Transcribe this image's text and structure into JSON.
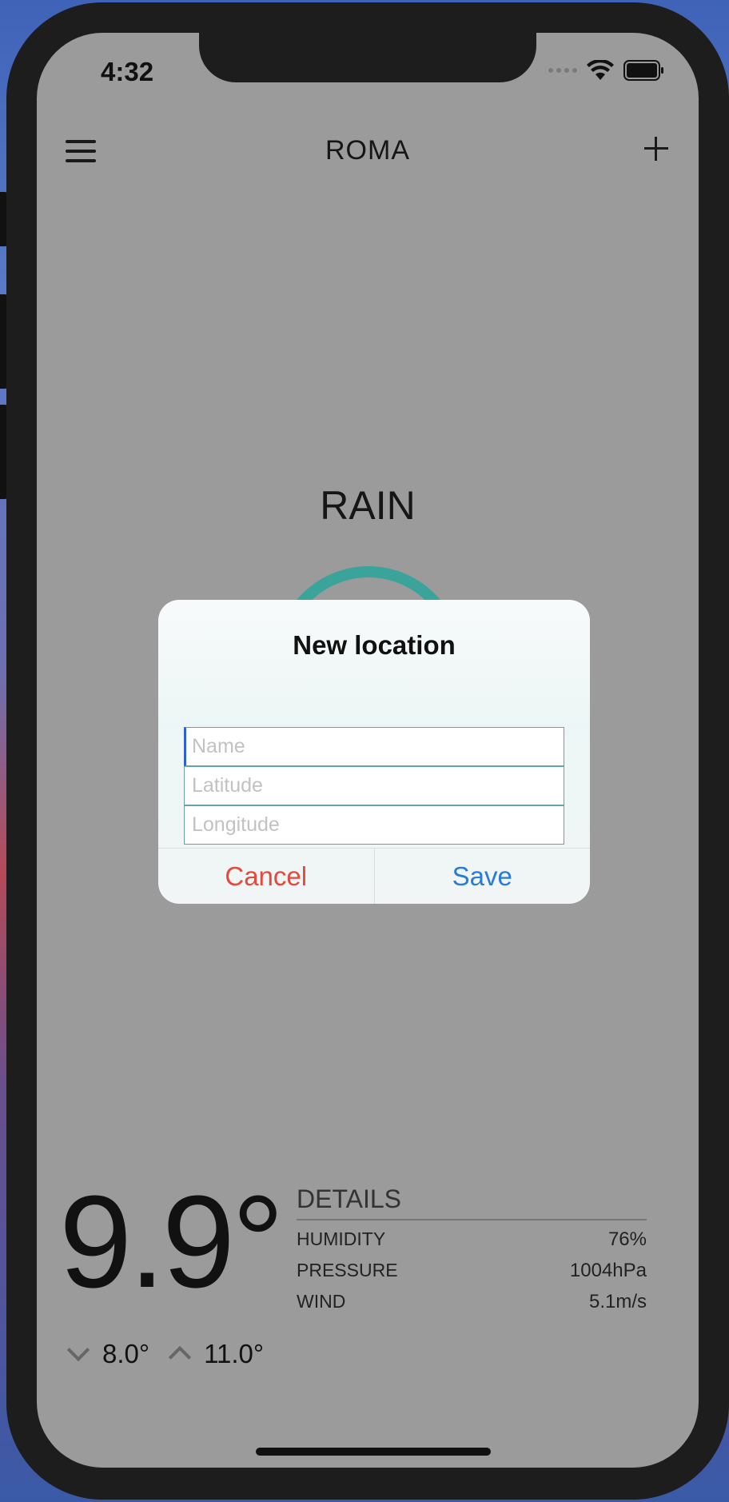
{
  "status_bar": {
    "time": "4:32"
  },
  "header": {
    "city": "ROMA"
  },
  "weather": {
    "condition": "RAIN",
    "temperature": "9.9°",
    "min_temp": "8.0°",
    "max_temp": "11.0°"
  },
  "details": {
    "title": "DETAILS",
    "rows": [
      {
        "label": "HUMIDITY",
        "value": "76%"
      },
      {
        "label": "PRESSURE",
        "value": "1004hPa"
      },
      {
        "label": "WIND",
        "value": "5.1m/s"
      }
    ]
  },
  "dialog": {
    "title": "New location",
    "name_placeholder": "Name",
    "latitude_placeholder": "Latitude",
    "longitude_placeholder": "Longitude",
    "cancel_label": "Cancel",
    "save_label": "Save"
  },
  "colors": {
    "accent_teal": "#3aa39a",
    "cancel_red": "#e14a3c",
    "save_blue": "#2a7bd8"
  }
}
